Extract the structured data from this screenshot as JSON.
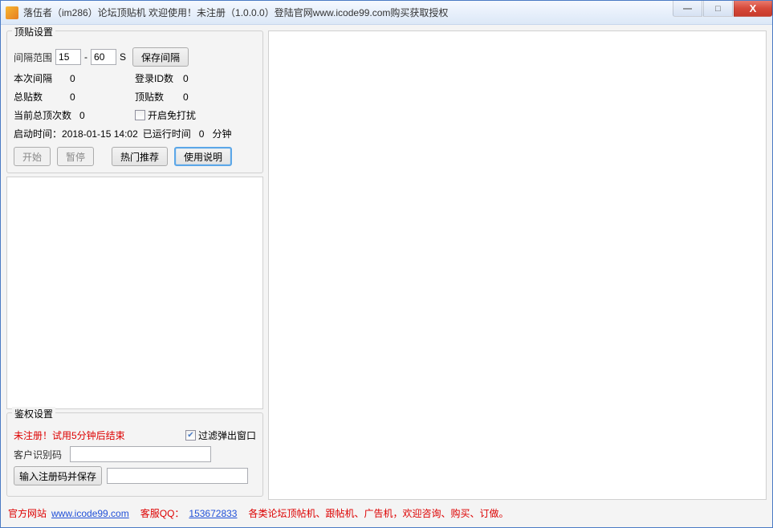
{
  "title": "落伍者（im286）论坛顶贴机  欢迎使用！未注册（1.0.0.0）登陆官网www.icode99.com购买获取授权",
  "settings": {
    "title": "顶贴设置",
    "interval_label": "间隔范围",
    "interval_min": "15",
    "dash": "-",
    "interval_max": "60",
    "unit": "S",
    "save_interval_btn": "保存间隔",
    "this_interval_label": "本次间隔",
    "this_interval_value": "0",
    "login_id_label": "登录ID数",
    "login_id_value": "0",
    "total_posts_label": "总贴数",
    "total_posts_value": "0",
    "top_posts_label": "顶贴数",
    "top_posts_value": "0",
    "current_top_label": "当前总顶次数",
    "current_top_value": "0",
    "dnd_label": "开启免打扰",
    "start_time_label": "启动时间：",
    "start_time_value": "2018-01-15 14:02",
    "run_time_label": "已运行时间",
    "run_time_value": "0",
    "minutes": "分钟",
    "start_btn": "开始",
    "pause_btn": "暂停",
    "hot_btn": "热门推荐",
    "usage_btn": "使用说明"
  },
  "auth": {
    "title": "鉴权设置",
    "unregistered_msg": "未注册！试用5分钟后结束",
    "filter_popup_label": "过滤弹出窗口",
    "filter_popup_checked": true,
    "client_id_label": "客户识别码",
    "client_id_value": "",
    "reg_btn": "输入注册码并保存",
    "reg_value": ""
  },
  "footer": {
    "site_label": "官方网站",
    "site_url": "www.icode99.com",
    "qq_label": "客服QQ：",
    "qq_number": "153672833",
    "tail": "各类论坛顶帖机、跟帖机、广告机，欢迎咨询、购买、订做。"
  },
  "win": {
    "min": "—",
    "max": "□",
    "close": "X"
  }
}
